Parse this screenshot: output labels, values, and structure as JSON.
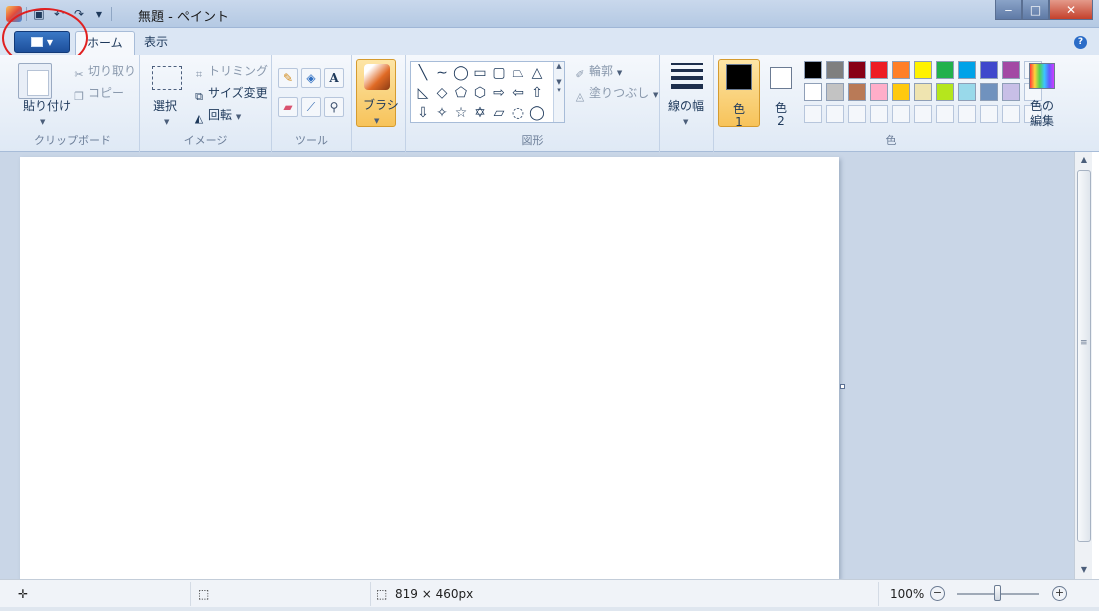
{
  "window": {
    "title": "無題 - ペイント",
    "controls": {
      "minimize": "‒",
      "maximize": "□",
      "close": "✕"
    }
  },
  "quick_access": {
    "save_icon": "save-icon",
    "undo_icon": "undo-icon",
    "redo_icon": "redo-icon",
    "customize_icon": "dropdown-icon"
  },
  "tabs": {
    "home": "ホーム",
    "view": "表示"
  },
  "ribbon": {
    "clipboard": {
      "group_label": "クリップボード",
      "paste": "貼り付け",
      "cut": "切り取り",
      "copy": "コピー"
    },
    "image": {
      "group_label": "イメージ",
      "select": "選択",
      "crop": "トリミング",
      "resize": "サイズ変更",
      "rotate": "回転"
    },
    "tools": {
      "group_label": "ツール",
      "text_glyph": "A"
    },
    "brush": {
      "label": "ブラシ"
    },
    "shapes": {
      "group_label": "図形",
      "outline": "輪郭",
      "fill": "塗りつぶし",
      "row1": [
        "╲",
        "∼",
        "◯",
        "▭",
        "▢",
        "⏢",
        "△"
      ],
      "row2": [
        "◺",
        "◇",
        "⬠",
        "⬡",
        "⇨",
        "⇦",
        "⇧"
      ],
      "row3": [
        "⇩",
        "✧",
        "☆",
        "✡",
        "▱",
        "◌",
        "◯"
      ]
    },
    "size": {
      "label": "線の幅"
    },
    "colors": {
      "group_label": "色",
      "color1_label": "色",
      "color1_num": "1",
      "color2_label": "色",
      "color2_num": "2",
      "edit_label_1": "色の",
      "edit_label_2": "編集",
      "color1_value": "#000000",
      "color2_value": "#ffffff",
      "palette": [
        "#000000",
        "#7f7f7f",
        "#880015",
        "#ed1c24",
        "#ff7f27",
        "#fff200",
        "#22b14c",
        "#00a2e8",
        "#3f48cc",
        "#a349a4",
        "#ffffff",
        "#c3c3c3",
        "#b97a57",
        "#ffaec9",
        "#ffc90e",
        "#efe4b0",
        "#b5e61d",
        "#99d9ea",
        "#7092be",
        "#c8bfe7"
      ]
    }
  },
  "statusbar": {
    "canvas_size": "819 × 460px",
    "zoom": "100%"
  }
}
